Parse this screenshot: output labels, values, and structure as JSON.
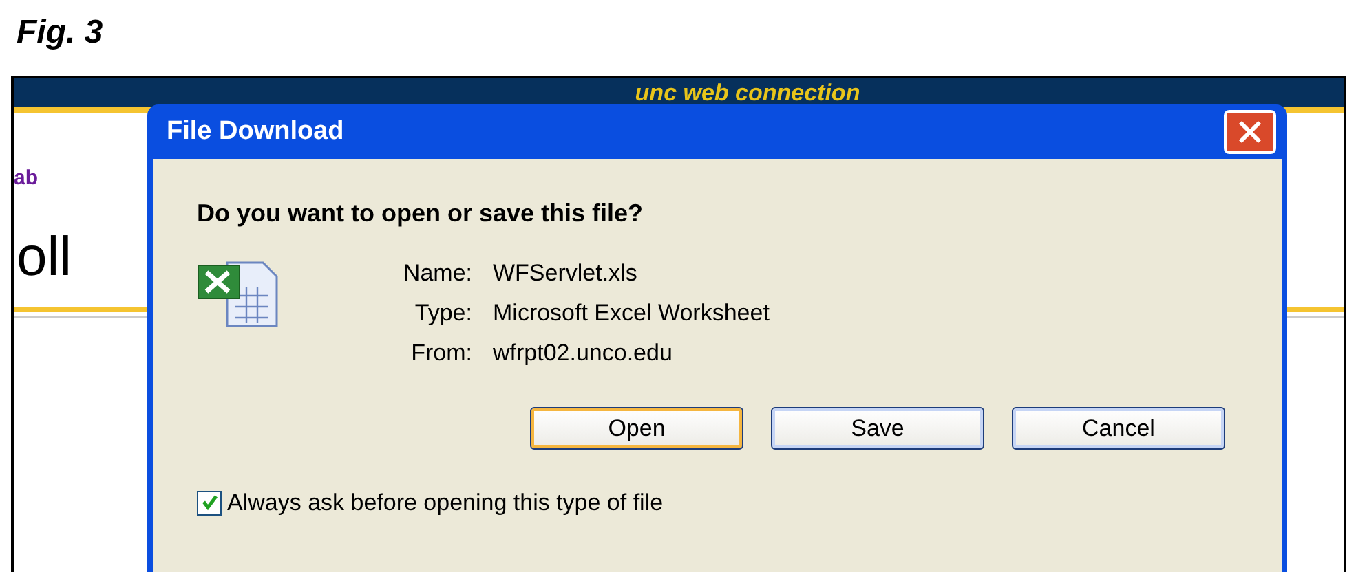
{
  "caption": "Fig. 3",
  "page": {
    "banner": "unc web connection",
    "link": "ab",
    "heading": "oll"
  },
  "dialog": {
    "title": "File Download",
    "question": "Do you want to open or save this file?",
    "fields": [
      {
        "label": "Name:",
        "value": "WFServlet.xls"
      },
      {
        "label": "Type:",
        "value": "Microsoft Excel Worksheet"
      },
      {
        "label": "From:",
        "value": "wfrpt02.unco.edu"
      }
    ],
    "buttons": [
      {
        "label": "Open",
        "selected": true
      },
      {
        "label": "Save",
        "selected": false
      },
      {
        "label": "Cancel",
        "selected": false
      }
    ],
    "checkbox": {
      "label": "Always ask before opening this type of file",
      "checked": true
    }
  }
}
